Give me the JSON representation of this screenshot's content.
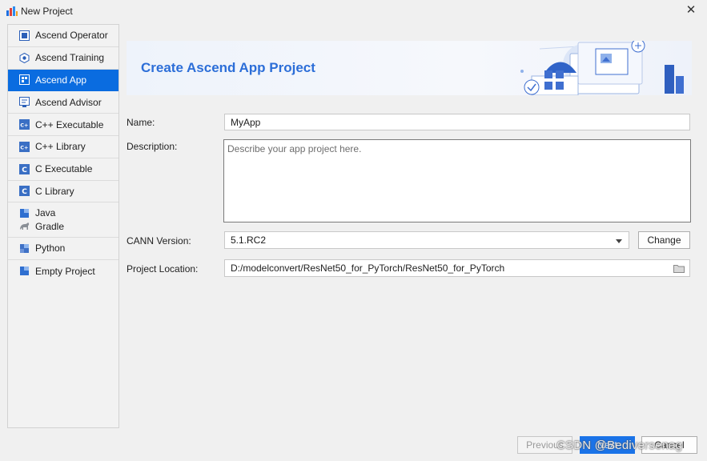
{
  "window": {
    "title": "New Project",
    "close_symbol": "✕"
  },
  "sidebar": {
    "items": [
      {
        "label": "Ascend Operator",
        "icon": "ascend-operator-icon"
      },
      {
        "label": "Ascend Training",
        "icon": "ascend-training-icon"
      },
      {
        "label": "Ascend App",
        "icon": "ascend-app-icon",
        "selected": true
      },
      {
        "label": "Ascend Advisor",
        "icon": "ascend-advisor-icon"
      },
      {
        "label": "C++ Executable",
        "icon": "cpp-icon"
      },
      {
        "label": "C++ Library",
        "icon": "cpp-icon"
      },
      {
        "label": "C Executable",
        "icon": "c-icon"
      },
      {
        "label": "C Library",
        "icon": "c-icon"
      },
      {
        "label": "Java",
        "icon": "java-icon"
      },
      {
        "label": "Gradle",
        "icon": "gradle-icon"
      },
      {
        "label": "Python",
        "icon": "python-icon"
      },
      {
        "label": "Empty Project",
        "icon": "empty-project-icon"
      }
    ]
  },
  "banner": {
    "title": "Create Ascend App Project"
  },
  "form": {
    "name_label": "Name:",
    "name_value": "MyApp",
    "description_label": "Description:",
    "description_placeholder": "Describe your app project here.",
    "cann_label": "CANN Version:",
    "cann_value": "5.1.RC2",
    "change_button": "Change",
    "location_label": "Project Location:",
    "location_value": "D:/modelconvert/ResNet50_for_PyTorch/ResNet50_for_PyTorch"
  },
  "footer": {
    "previous_label": "Previous",
    "next_label": "Next",
    "cancel_label": "Cancel"
  },
  "watermark": "CSDN @Bediversenag",
  "colors": {
    "selection": "#0a6ce0",
    "banner_title": "#2c6ed8",
    "primary_button": "#1a73e8"
  }
}
